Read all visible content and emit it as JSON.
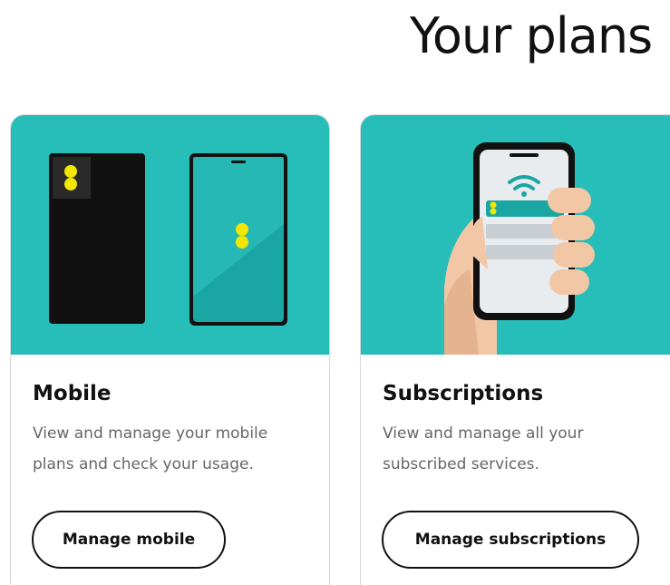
{
  "page": {
    "title": "Your plans"
  },
  "colors": {
    "hero_teal": "#27bdb9",
    "ee_yellow": "#f3e600",
    "border_grey": "#d6d6d6"
  },
  "cards": [
    {
      "title": "Mobile",
      "description": "View and manage your mobile plans and check your usage.",
      "button_label": "Manage mobile",
      "illustration": "sim-card-and-phone"
    },
    {
      "title": "Subscriptions",
      "description": "View and manage all your subscribed services.",
      "button_label": "Manage subscriptions",
      "illustration": "hand-holding-phone"
    }
  ]
}
